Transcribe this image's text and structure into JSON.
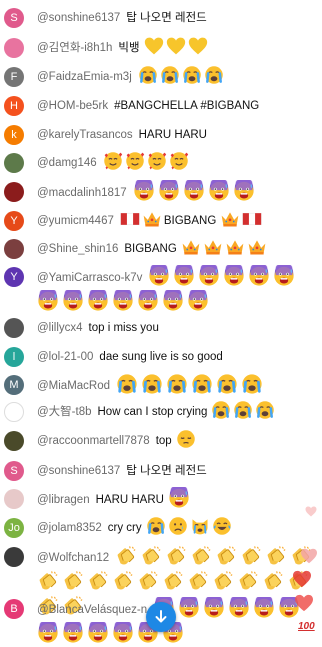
{
  "messages": [
    {
      "author": "@sonshine6137",
      "text": "탑 나오면 레전드",
      "avatar": {
        "letter": "S",
        "color": "#e05a8c"
      },
      "emojis": []
    },
    {
      "author": "@김연화-i8h1h",
      "text": "빅뱅",
      "avatar": {
        "letter": "",
        "color": "#e8739f"
      },
      "emojis": [
        "yellow-heart",
        "yellow-heart",
        "yellow-heart"
      ]
    },
    {
      "author": "@FaidzaEmia-m3j",
      "text": "",
      "avatar": {
        "letter": "F",
        "color": "#757575"
      },
      "emojis": [
        "crying-face",
        "crying-face",
        "crying-face",
        "crying-face"
      ]
    },
    {
      "author": "@HOM-be5rk",
      "text": "#BANGCHELLA #BIGBANG",
      "avatar": {
        "letter": "H",
        "color": "#f4511e"
      },
      "emojis": []
    },
    {
      "author": "@karelyTrasancos",
      "text": "HARU HARU",
      "avatar": {
        "letter": "k",
        "color": "#f57c00"
      },
      "emojis": []
    },
    {
      "author": "@damg146",
      "text": "",
      "avatar": {
        "letter": "",
        "color": "#5d7a4a"
      },
      "emojis": [
        "smiling-hearts-face",
        "smiling-hearts-face",
        "smiling-hearts-face",
        "smiling-hearts-face"
      ]
    },
    {
      "author": "@macdalinh1817",
      "text": "",
      "avatar": {
        "letter": "",
        "color": "#8b1c1c"
      },
      "emojis": [
        "cold-sweat-face",
        "cold-sweat-face",
        "cold-sweat-face",
        "cold-sweat-face",
        "cold-sweat-face"
      ]
    },
    {
      "author": "@yumicm4467",
      "text": "BIGBANG",
      "avatar": {
        "letter": "Y",
        "color": "#e64a19"
      },
      "emojis_before": [
        "peru-flag",
        "crown"
      ],
      "emojis": [
        "crown",
        "peru-flag"
      ]
    },
    {
      "author": "@Shine_shin16",
      "text": "BIGBANG",
      "avatar": {
        "letter": "",
        "color": "#7b3f3f"
      },
      "emojis": [
        "crown",
        "crown",
        "crown",
        "crown"
      ]
    },
    {
      "author": "@YamiCarrasco-k7v",
      "text": "",
      "avatar": {
        "letter": "Y",
        "color": "#5e35b1"
      },
      "emojis": [
        "cold-sweat-face",
        "cold-sweat-face",
        "cold-sweat-face",
        "cold-sweat-face",
        "cold-sweat-face",
        "cold-sweat-face",
        "cold-sweat-face",
        "cold-sweat-face",
        "cold-sweat-face",
        "cold-sweat-face",
        "cold-sweat-face",
        "cold-sweat-face",
        "cold-sweat-face"
      ]
    },
    {
      "author": "@lillycx4",
      "text": "top i miss you",
      "avatar": {
        "letter": "",
        "color": "#555555"
      },
      "emojis": []
    },
    {
      "author": "@lol-21-00",
      "text": "dae sung live is so good",
      "avatar": {
        "letter": "l",
        "color": "#26a69a"
      },
      "emojis": []
    },
    {
      "author": "@MiaMacRod",
      "text": "",
      "avatar": {
        "letter": "M",
        "color": "#546e7a"
      },
      "emojis": [
        "crying-face",
        "crying-face",
        "crying-face",
        "crying-face",
        "crying-face",
        "crying-face"
      ]
    },
    {
      "author": "@大智-t8b",
      "text": "How can I stop crying",
      "avatar": {
        "letter": "",
        "color": "#ffffff"
      },
      "emojis": [
        "crying-face",
        "crying-face",
        "crying-face"
      ]
    },
    {
      "author": "@raccoonmartell7878",
      "text": "top",
      "avatar": {
        "letter": "",
        "color": "#4a4a2a"
      },
      "emojis": [
        "pensive-face"
      ]
    },
    {
      "author": "@sonshine6137",
      "text": "탑 나오면 레전드",
      "avatar": {
        "letter": "S",
        "color": "#e05a8c"
      },
      "emojis": []
    },
    {
      "author": "@libragen",
      "text": "HARU HARU",
      "avatar": {
        "letter": "",
        "color": "#e7c9c9"
      },
      "emojis": [
        "cold-sweat-face"
      ]
    },
    {
      "author": "@jolam8352",
      "text": "cry cry",
      "avatar": {
        "letter": "Jo",
        "color": "#7cb342"
      },
      "emojis": [
        "crying-face",
        "sad-face",
        "crying-cat",
        "joy-face"
      ]
    },
    {
      "author": "@Wolfchan12",
      "text": "",
      "avatar": {
        "letter": "",
        "color": "#3a3a3a"
      },
      "emojis": [
        "clap",
        "clap",
        "clap",
        "clap",
        "clap",
        "clap",
        "clap",
        "clap",
        "clap",
        "clap",
        "clap",
        "clap",
        "clap",
        "clap",
        "clap",
        "clap",
        "clap",
        "clap",
        "clap",
        "clap",
        "clap"
      ]
    },
    {
      "author": "@BlancaVelásquez-n",
      "text": "",
      "avatar": {
        "letter": "B",
        "color": "#e53975"
      },
      "emojis": [
        "cold-sweat-face",
        "cold-sweat-face",
        "cold-sweat-face",
        "cold-sweat-face",
        "cold-sweat-face",
        "cold-sweat-face",
        "cold-sweat-face",
        "cold-sweat-face",
        "cold-sweat-face",
        "cold-sweat-face",
        "cold-sweat-face",
        "cold-sweat-face"
      ]
    }
  ],
  "scroll_button": {
    "icon": "arrow-down-icon",
    "color": "#1e88e5"
  },
  "reaction_overlay": {
    "icons": [
      "heart-icon",
      "hundred-points-icon"
    ],
    "hundred_label": "100"
  }
}
